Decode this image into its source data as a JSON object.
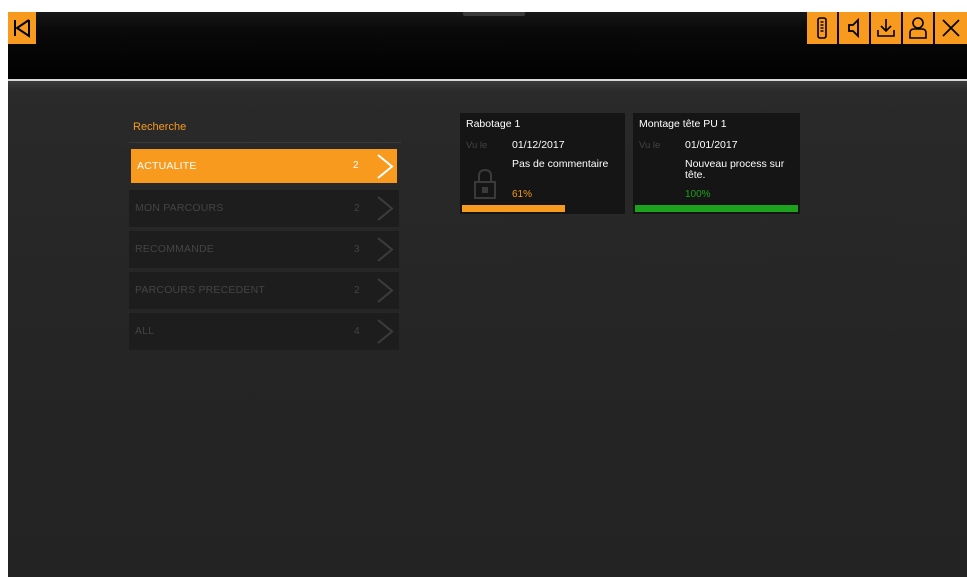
{
  "toolbar": {
    "back_icon": "back-icon",
    "right_icons": [
      "remote-icon",
      "sound-icon",
      "download-icon",
      "user-icon",
      "close-icon"
    ],
    "accent": "#f79a1e"
  },
  "search": {
    "title": "Recherche",
    "items": [
      {
        "label": "ACTUALITE",
        "count": "2",
        "active": true
      },
      {
        "label": "MON PARCOURS",
        "count": "2",
        "active": false
      },
      {
        "label": "RECOMMANDE",
        "count": "3",
        "active": false
      },
      {
        "label": "PARCOURS PRECEDENT",
        "count": "2",
        "active": false
      },
      {
        "label": "ALL",
        "count": "4",
        "active": false
      }
    ]
  },
  "cards": [
    {
      "title": "Rabotage 1",
      "vu_label": "Vu le",
      "date": "01/12/2017",
      "comment": "Pas de commentaire",
      "percent": "61%",
      "progress": 0.64,
      "color": "#f79a1e",
      "locked": true
    },
    {
      "title": "Montage tête PU 1",
      "vu_label": "Vu le",
      "date": "01/01/2017",
      "comment": "Nouveau process sur tête.",
      "percent": "100%",
      "progress": 1.0,
      "color": "#1ca21c",
      "locked": false
    }
  ]
}
